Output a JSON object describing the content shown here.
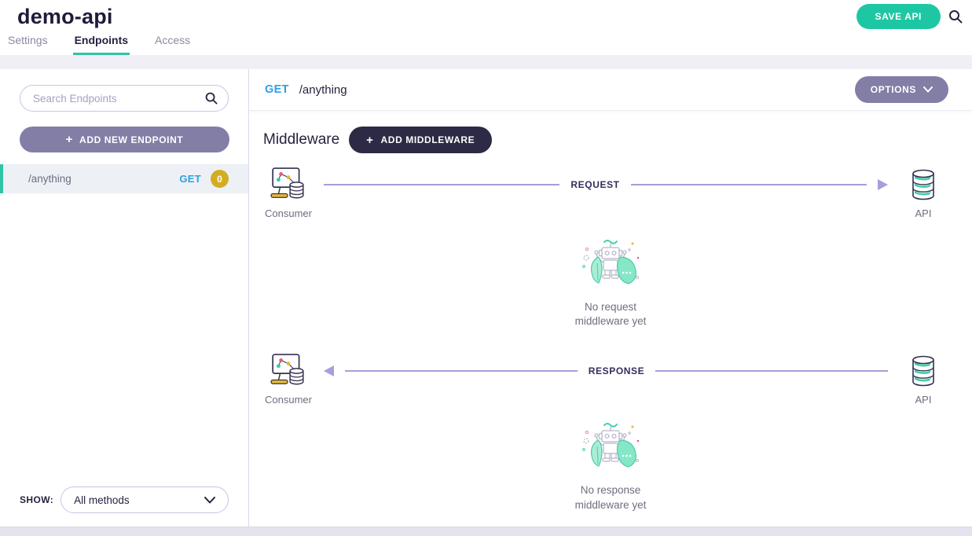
{
  "header": {
    "title": "demo-api",
    "tabs": [
      {
        "label": "Settings"
      },
      {
        "label": "Endpoints"
      },
      {
        "label": "Access"
      }
    ],
    "active_tab": "Endpoints",
    "save_button_label": "SAVE API"
  },
  "sidebar": {
    "search_placeholder": "Search Endpoints",
    "add_endpoint_label": "ADD NEW ENDPOINT",
    "endpoints": [
      {
        "path": "/anything",
        "method": "GET",
        "middleware_count": "0",
        "selected": true
      }
    ],
    "show_label": "SHOW:",
    "method_filter_value": "All methods"
  },
  "main": {
    "endpoint_header": {
      "method": "GET",
      "path": "/anything",
      "options_button_label": "OPTIONS"
    },
    "middleware": {
      "heading": "Middleware",
      "add_button_label": "ADD MIDDLEWARE",
      "request_flow": {
        "label": "REQUEST",
        "from_label": "Consumer",
        "to_label": "API",
        "empty_line1": "No request",
        "empty_line2": "middleware yet"
      },
      "response_flow": {
        "label": "RESPONSE",
        "from_label": "Consumer",
        "to_label": "API",
        "empty_line1": "No response",
        "empty_line2": "middleware yet"
      }
    }
  },
  "icons": {
    "plus": "+",
    "search": "magnifier",
    "chevron_down": "⌄"
  },
  "colors": {
    "accent_teal": "#1ec7a3",
    "tab_underline_teal": "#2ec4a5",
    "dark_navy": "#26233f",
    "button_dark": "#2d2a45",
    "muted_purple": "#827ea6",
    "arrow_lavender": "#a59fd9",
    "method_blue": "#2e9fe6",
    "badge_gold": "#d3ac22",
    "selected_row_bg": "#edf0f5",
    "illustration_mint": "#8ae8c9"
  }
}
